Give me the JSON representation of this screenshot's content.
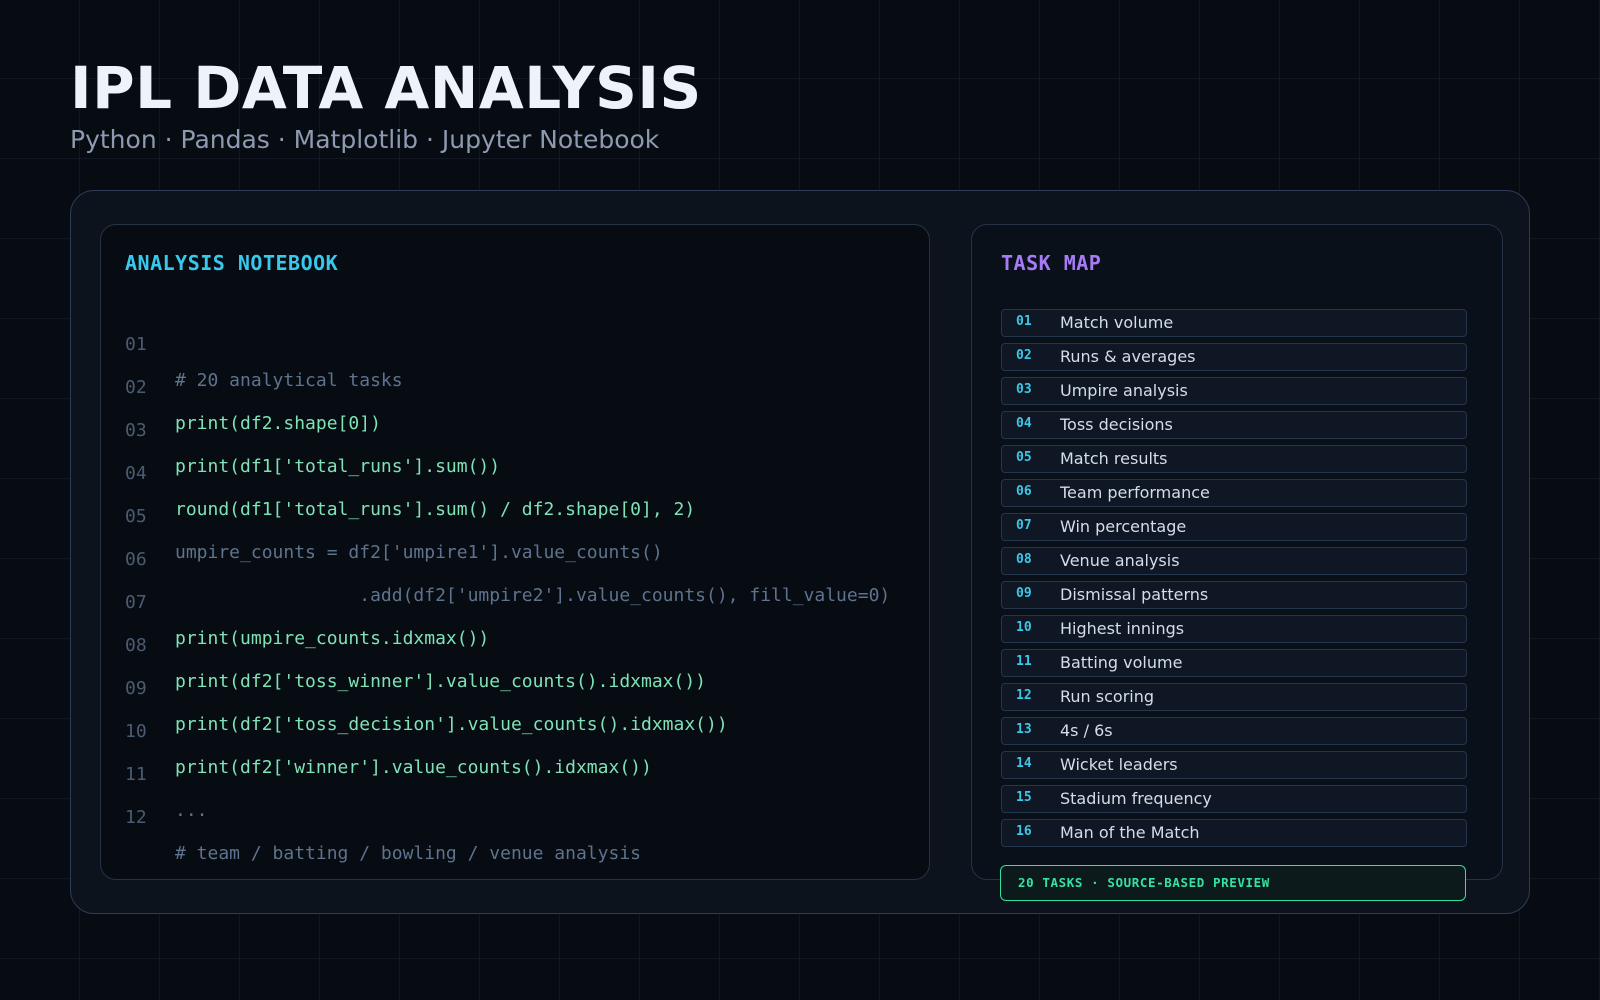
{
  "header": {
    "title": "IPL DATA ANALYSIS",
    "subtitle": "Python · Pandas · Matplotlib · Jupyter Notebook"
  },
  "notebook": {
    "title": "ANALYSIS NOTEBOOK",
    "lines": [
      {
        "num": "01",
        "code": "# 20 analytical tasks",
        "style": "comment"
      },
      {
        "num": "02",
        "code": "print(df2.shape[0])",
        "style": "code"
      },
      {
        "num": "03",
        "code": "print(df1['total_runs'].sum())",
        "style": "code"
      },
      {
        "num": "04",
        "code": "round(df1['total_runs'].sum() / df2.shape[0], 2)",
        "style": "code"
      },
      {
        "num": "05",
        "code": "umpire_counts = df2['umpire1'].value_counts()",
        "style": "muted"
      },
      {
        "num": "06",
        "code": "                 .add(df2['umpire2'].value_counts(), fill_value=0)",
        "style": "muted"
      },
      {
        "num": "07",
        "code": "print(umpire_counts.idxmax())",
        "style": "code"
      },
      {
        "num": "08",
        "code": "print(df2['toss_winner'].value_counts().idxmax())",
        "style": "code"
      },
      {
        "num": "09",
        "code": "print(df2['toss_decision'].value_counts().idxmax())",
        "style": "code"
      },
      {
        "num": "10",
        "code": "print(df2['winner'].value_counts().idxmax())",
        "style": "code"
      },
      {
        "num": "11",
        "code": "...",
        "style": "muted"
      },
      {
        "num": "12",
        "code": "# team / batting / bowling / venue analysis",
        "style": "comment"
      }
    ]
  },
  "task_map": {
    "title": "TASK MAP",
    "tasks": [
      {
        "num": "01",
        "label": "Match volume"
      },
      {
        "num": "02",
        "label": "Runs & averages"
      },
      {
        "num": "03",
        "label": "Umpire analysis"
      },
      {
        "num": "04",
        "label": "Toss decisions"
      },
      {
        "num": "05",
        "label": "Match results"
      },
      {
        "num": "06",
        "label": "Team performance"
      },
      {
        "num": "07",
        "label": "Win percentage"
      },
      {
        "num": "08",
        "label": "Venue analysis"
      },
      {
        "num": "09",
        "label": "Dismissal patterns"
      },
      {
        "num": "10",
        "label": "Highest innings"
      },
      {
        "num": "11",
        "label": "Batting volume"
      },
      {
        "num": "12",
        "label": "Run scoring"
      },
      {
        "num": "13",
        "label": "4s / 6s"
      },
      {
        "num": "14",
        "label": "Wicket leaders"
      },
      {
        "num": "15",
        "label": "Stadium frequency"
      },
      {
        "num": "16",
        "label": "Man of the Match"
      }
    ],
    "summary": "20 TASKS · SOURCE-BASED PREVIEW"
  },
  "colors": {
    "background": "#070b12",
    "accent_cyan": "#38c8ec",
    "accent_purple": "#a57cf6",
    "accent_green": "#35e2a1",
    "code_green": "#7fe3b6"
  }
}
